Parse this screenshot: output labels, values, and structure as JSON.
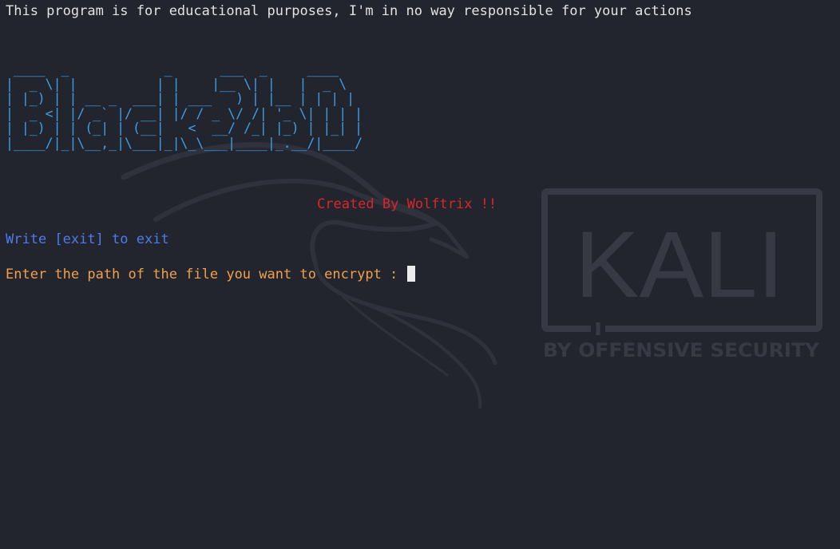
{
  "terminal": {
    "disclaimer": "This program is for educational purposes, I'm in no way responsible for your actions",
    "banner_lines": [
      " ____  _            _      ___  _     ____",
      "|  _ \\| |          | |    |__ \\| |   |  _ \\",
      "| |_) | | __ _  ___| | ___   ) | |__ | | | |",
      "|  _ <| |/ _` |/ __| |/ / _ \\/ /| '_ \\| | | |",
      "| |_) | | (_| | (__|   <  __/ /_| |_) | |_| |",
      "|____/|_|\\__,_|\\___|_|\\_\\___|____|_.__/|____/"
    ],
    "credit": "Created By Wolftrix !!",
    "exit_hint": "Write [exit] to exit",
    "prompt": "Enter the path of the file you want to encrypt : "
  },
  "wallpaper": {
    "brand": "KALI",
    "tagline": "BY OFFENSIVE SECURITY"
  },
  "colors": {
    "background": "#23252e",
    "banner": "#3d9ee8",
    "credit": "#d9262a",
    "exit_hint": "#4f7be8",
    "prompt": "#f0a04b",
    "cursor": "#ececec",
    "watermark": "#3a3d47"
  }
}
